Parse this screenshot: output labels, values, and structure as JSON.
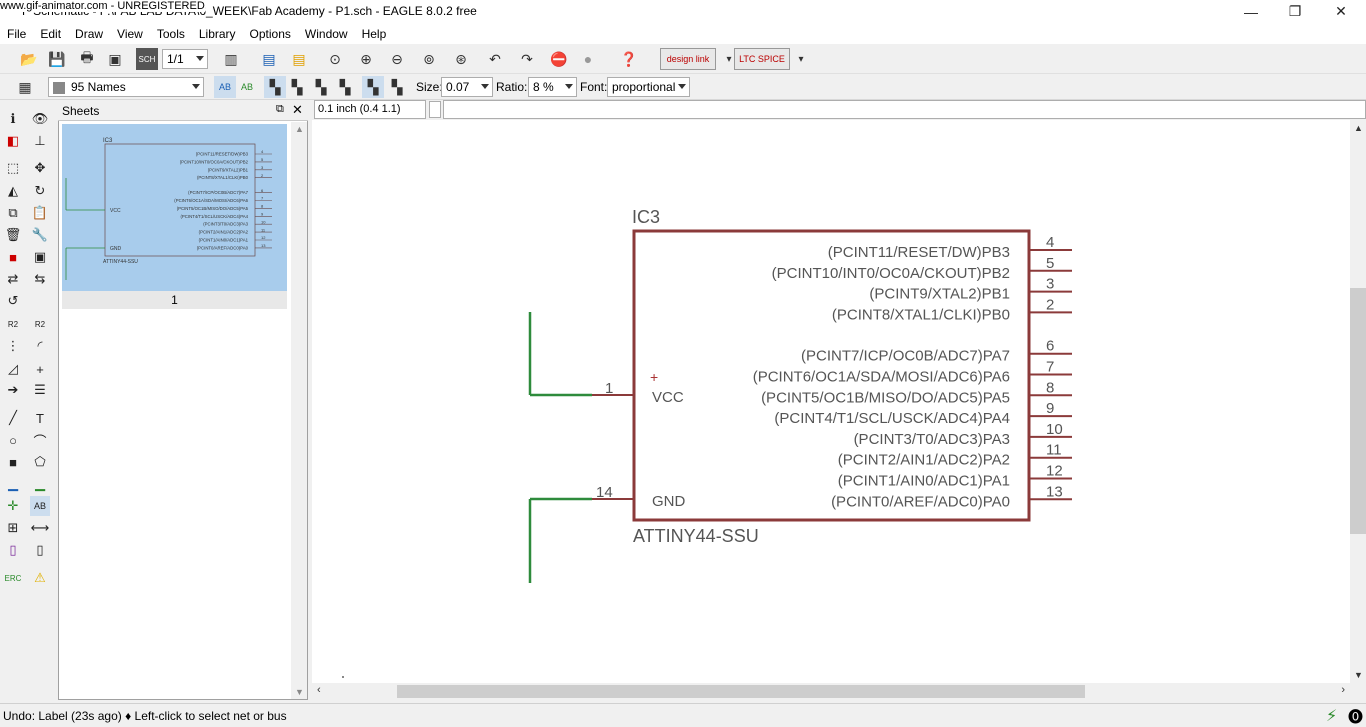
{
  "window": {
    "title": "P Schematic - F:\\FAB LAB DATA\\6_WEEK\\Fab Academy - P1.sch - EAGLE 8.0.2 free",
    "watermark": "www.gif-animator.com - UNREGISTERED",
    "minimize": "—",
    "maximize": "❐",
    "close": "✕"
  },
  "menu": [
    {
      "label": "File"
    },
    {
      "label": "Edit"
    },
    {
      "label": "Draw"
    },
    {
      "label": "View"
    },
    {
      "label": "Tools"
    },
    {
      "label": "Library"
    },
    {
      "label": "Options"
    },
    {
      "label": "Window"
    },
    {
      "label": "Help"
    }
  ],
  "toolbar": {
    "sheet_select": "1/1",
    "design_link": "design link",
    "ltc_spice": "LTC SPICE"
  },
  "param_bar": {
    "layer": "95 Names",
    "size_label": "Size:",
    "size_value": "0.07",
    "ratio_label": "Ratio:",
    "ratio_value": "8 %",
    "font_label": "Font:",
    "font_value": "proportional"
  },
  "sheets_panel": {
    "title": "Sheets",
    "sheet_number": "1"
  },
  "coord_display": "0.1 inch (0.4 1.1)",
  "command_input": "",
  "part": {
    "name": "IC3",
    "value": "ATTINY44-SSU",
    "pins_right": [
      {
        "label": "(PCINT11/RESET/DW)PB3",
        "num": "4"
      },
      {
        "label": "(PCINT10/INT0/OC0A/CKOUT)PB2",
        "num": "5"
      },
      {
        "label": "(PCINT9/XTAL2)PB1",
        "num": "3"
      },
      {
        "label": "(PCINT8/XTAL1/CLKI)PB0",
        "num": "2"
      },
      {
        "label": "(PCINT7/ICP/OC0B/ADC7)PA7",
        "num": "6"
      },
      {
        "label": "(PCINT6/OC1A/SDA/MOSI/ADC6)PA6",
        "num": "7"
      },
      {
        "label": "(PCINT5/OC1B/MISO/DO/ADC5)PA5",
        "num": "8"
      },
      {
        "label": "(PCINT4/T1/SCL/USCK/ADC4)PA4",
        "num": "9"
      },
      {
        "label": "(PCINT3/T0/ADC3)PA3",
        "num": "10"
      },
      {
        "label": "(PCINT2/AIN1/ADC2)PA2",
        "num": "11"
      },
      {
        "label": "(PCINT1/AIN0/ADC1)PA1",
        "num": "12"
      },
      {
        "label": "(PCINT0/AREF/ADC0)PA0",
        "num": "13"
      }
    ],
    "pin_vcc": {
      "label": "VCC",
      "num": "1"
    },
    "pin_gnd": {
      "label": "GND",
      "num": "14"
    }
  },
  "status": {
    "message": "Undo: Label (23s ago) ♦ Left-click to select net or bus"
  },
  "colors": {
    "part_outline": "#8b3a3a",
    "net_wire": "#2e8b3c",
    "selection": "#a8ccec"
  }
}
